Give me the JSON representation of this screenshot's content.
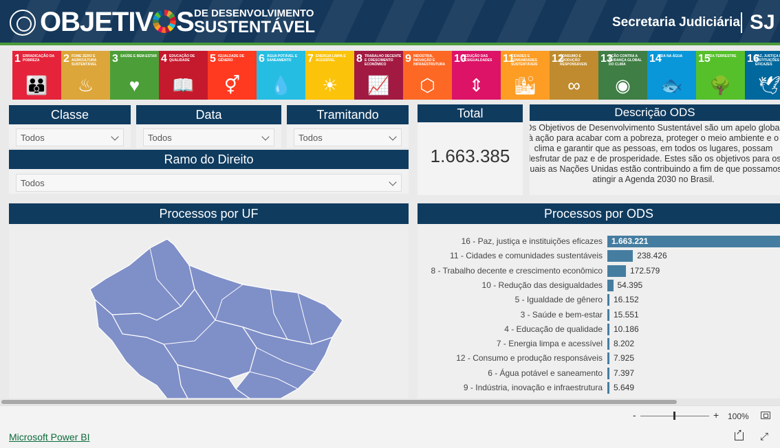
{
  "header": {
    "brand_big": "OBJETIV",
    "brand_big_end": "S",
    "brand_small_line1": "DE DESENVOLVIMENTO",
    "brand_small_line2": "SUSTENTÁVEL",
    "secretaria": "Secretaria Judiciária",
    "sj": "SJ"
  },
  "ods_tiles": [
    {
      "num": "1",
      "label": "Erradicação da pobreza",
      "color": "#e5243b",
      "glyph": "👪"
    },
    {
      "num": "2",
      "label": "Fome zero e agricultura sustentável",
      "color": "#dda63a",
      "glyph": "♨"
    },
    {
      "num": "3",
      "label": "Saúde e bem-estar",
      "color": "#4c9f38",
      "glyph": "♥"
    },
    {
      "num": "4",
      "label": "Educação de qualidade",
      "color": "#c5192d",
      "glyph": "📖"
    },
    {
      "num": "5",
      "label": "Igualdade de gênero",
      "color": "#ff3a21",
      "glyph": "⚥"
    },
    {
      "num": "6",
      "label": "Água potável e saneamento",
      "color": "#26bde2",
      "glyph": "💧"
    },
    {
      "num": "7",
      "label": "Energia limpa e acessível",
      "color": "#fcc30b",
      "glyph": "☀"
    },
    {
      "num": "8",
      "label": "Trabalho decente e crescimento econômico",
      "color": "#a21942",
      "glyph": "📈"
    },
    {
      "num": "9",
      "label": "Indústria, inovação e infraestrutura",
      "color": "#fd6925",
      "glyph": "⬡"
    },
    {
      "num": "10",
      "label": "Redução das desigualdades",
      "color": "#dd1367",
      "glyph": "⇕"
    },
    {
      "num": "11",
      "label": "Cidades e comunidades sustentáveis",
      "color": "#fd9d24",
      "glyph": "🏙"
    },
    {
      "num": "12",
      "label": "Consumo e produção responsáveis",
      "color": "#bf8b2e",
      "glyph": "∞"
    },
    {
      "num": "13",
      "label": "Ação contra a mudança global do clima",
      "color": "#3f7e44",
      "glyph": "◉"
    },
    {
      "num": "14",
      "label": "Vida na água",
      "color": "#0a97d9",
      "glyph": "🐟"
    },
    {
      "num": "15",
      "label": "Vida terrestre",
      "color": "#56c02b",
      "glyph": "🌳"
    },
    {
      "num": "16",
      "label": "Paz, justiça e instituições eficazes",
      "color": "#00689d",
      "glyph": "🕊"
    }
  ],
  "filters": {
    "classe": {
      "title": "Classe",
      "value": "Todos"
    },
    "data": {
      "title": "Data",
      "value": "Todos"
    },
    "tramitando": {
      "title": "Tramitando",
      "value": "Todos"
    },
    "ramo": {
      "title": "Ramo do Direito",
      "value": "Todos"
    }
  },
  "total": {
    "title": "Total",
    "value": "1.663.385"
  },
  "descricao": {
    "title": "Descrição ODS",
    "text": "Os Objetivos de Desenvolvimento Sustentável são um apelo global à ação para acabar com a pobreza, proteger o meio ambiente e o clima e garantir que as pessoas, em todos os lugares, possam desfrutar de paz e de prosperidade. Estes são os objetivos para os quais as Nações Unidas estão contribuindo a fim de que possamos atingir a Agenda 2030 no Brasil."
  },
  "uf_panel": {
    "title": "Processos por UF"
  },
  "ods_panel": {
    "title": "Processos por ODS"
  },
  "chart_data": {
    "type": "bar",
    "orientation": "horizontal",
    "title": "Processos por ODS",
    "categories": [
      "16 - Paz, justiça e instituições eficazes",
      "11 - Cidades e comunidades sustentáveis",
      "8 - Trabalho decente e crescimento econômico",
      "10 - Redução das desigualdades",
      "5 - Igualdade de gênero",
      "3 - Saúde e bem-estar",
      "4 - Educação de qualidade",
      "7 - Energia limpa e acessível",
      "12 - Consumo e produção responsáveis",
      "6 - Água potável e saneamento",
      "9 - Indústria, inovação e infraestrutura"
    ],
    "values": [
      1663221,
      238426,
      172579,
      54395,
      16152,
      15551,
      10186,
      8202,
      7925,
      7397,
      5649
    ],
    "value_labels": [
      "1.663.221",
      "238.426",
      "172.579",
      "54.395",
      "16.152",
      "15.551",
      "10.186",
      "8.202",
      "7.925",
      "7.397",
      "5.649"
    ],
    "bar_color": "#457da0"
  },
  "zoom": {
    "minus": "-",
    "plus": "+",
    "level": "100%"
  },
  "footer": {
    "powerbi_link": "Microsoft Power BI"
  }
}
